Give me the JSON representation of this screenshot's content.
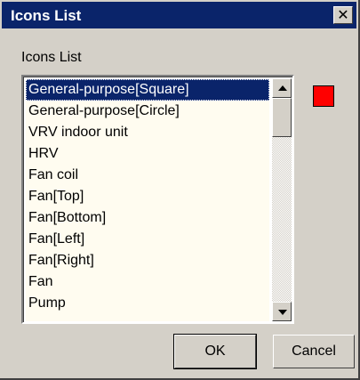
{
  "window": {
    "title": "Icons List",
    "close_symbol": "✕"
  },
  "group_label": "Icons List",
  "list": {
    "items": [
      "General-purpose[Square]",
      "General-purpose[Circle]",
      "VRV indoor unit",
      "HRV",
      "Fan coil",
      "Fan[Top]",
      "Fan[Bottom]",
      "Fan[Left]",
      "Fan[Right]",
      "Fan",
      "Pump"
    ],
    "selected_index": 0
  },
  "preview": {
    "color": "#ff0000",
    "icon": "square-icon"
  },
  "buttons": {
    "ok_label": "OK",
    "cancel_label": "Cancel"
  }
}
